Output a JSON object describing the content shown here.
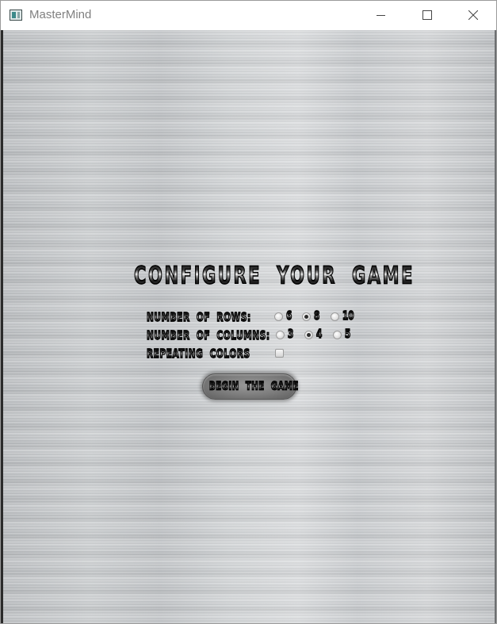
{
  "window": {
    "title": "MasterMind",
    "controls": [
      "minimize",
      "maximize",
      "close"
    ]
  },
  "config": {
    "heading": "Configure your game",
    "rows": {
      "label": "Number of rows:",
      "options": [
        "6",
        "8",
        "10"
      ],
      "selected": "8"
    },
    "columns": {
      "label": "Number of columns:",
      "options": [
        "3",
        "4",
        "5"
      ],
      "selected": "4"
    },
    "repeating": {
      "label": "Repeating colors",
      "checked": false
    },
    "begin_button_label": "Begin the game"
  },
  "icons": {
    "app": "mastermind-app-icon",
    "minimize": "minimize-icon",
    "maximize": "maximize-icon",
    "close": "close-icon"
  }
}
